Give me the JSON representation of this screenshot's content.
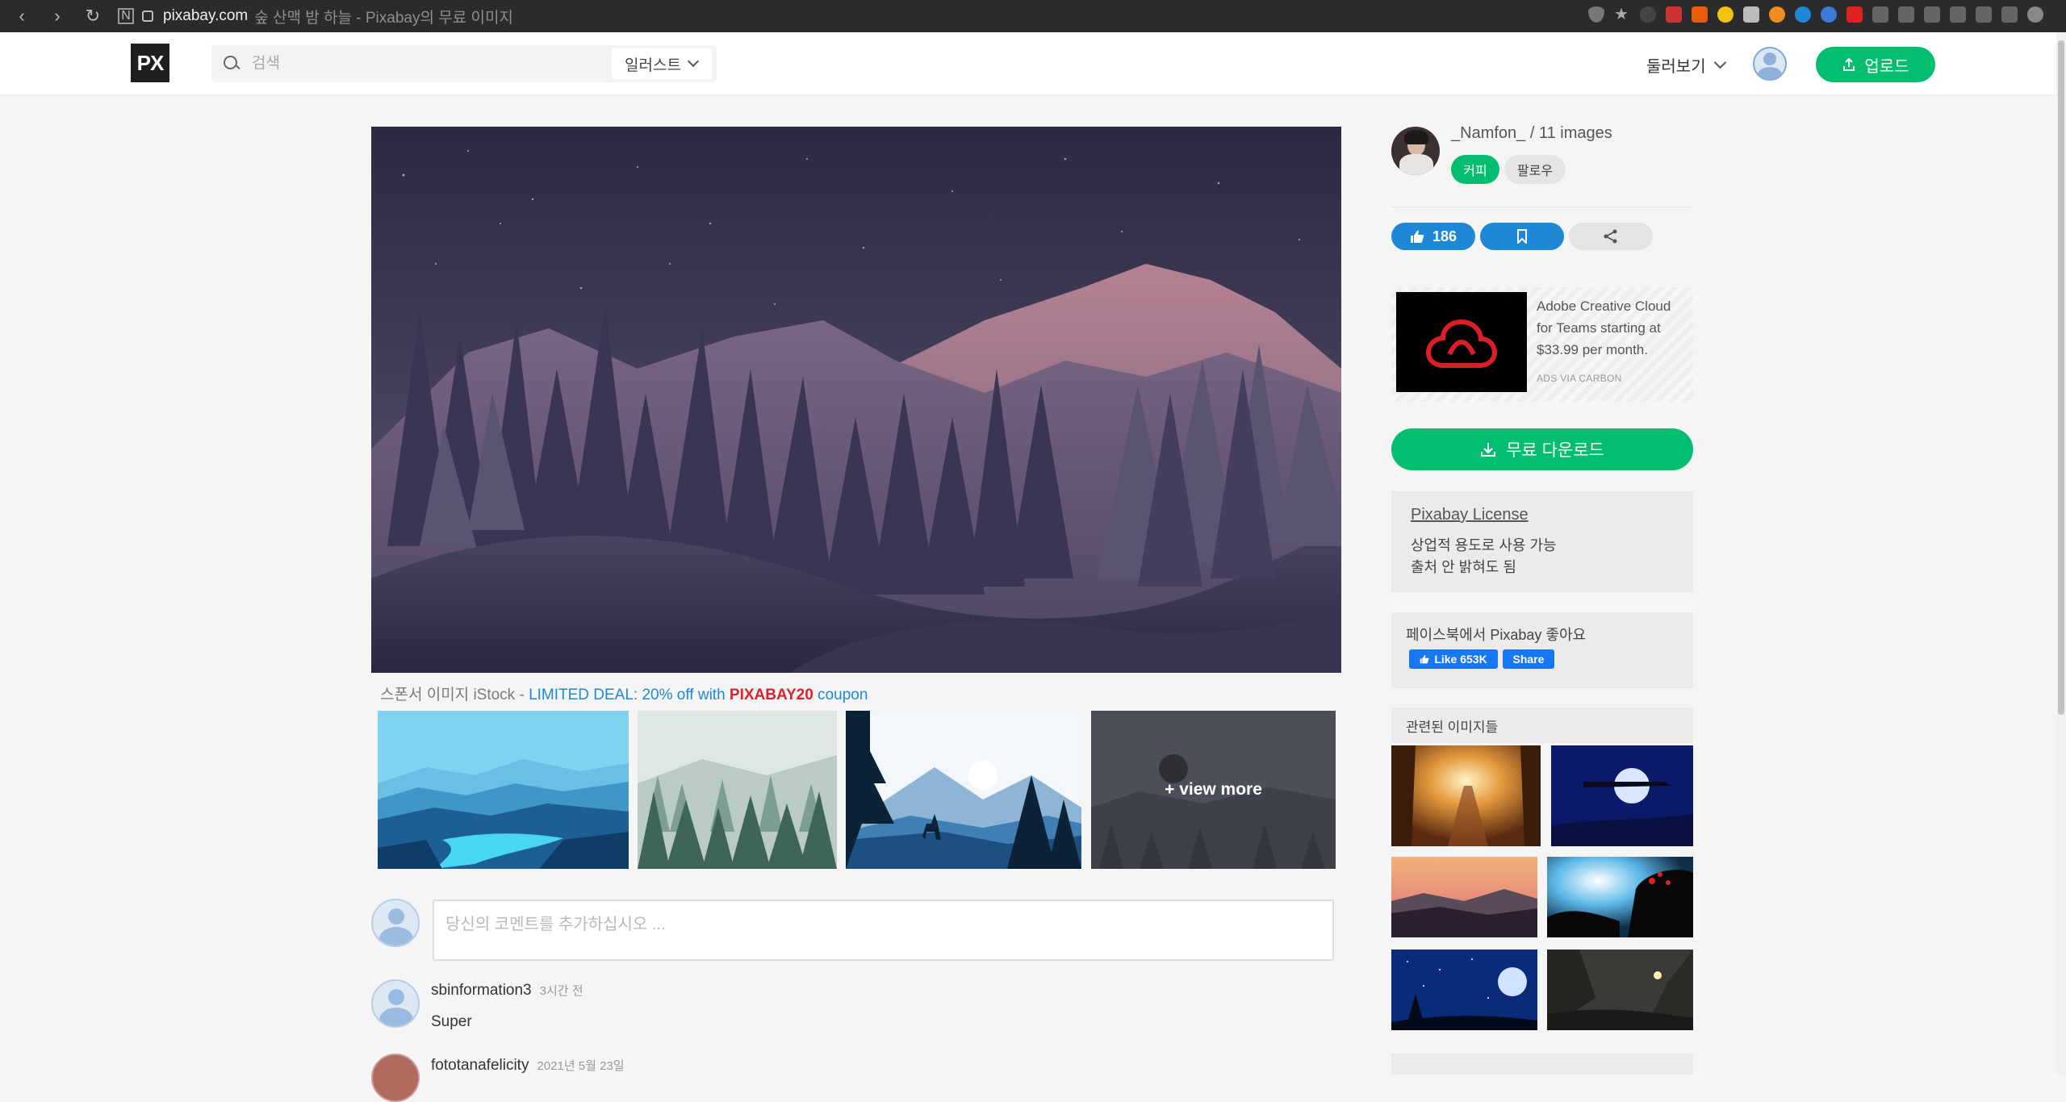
{
  "browser": {
    "host": "pixabay.com",
    "title": "숲 산맥 밤 하늘 - Pixabay의 무료 이미지"
  },
  "header": {
    "logo": "PX",
    "search_placeholder": "검색",
    "search_type": "일러스트",
    "explore_label": "둘러보기",
    "upload_label": "업로드"
  },
  "sponsor": {
    "prefix": "스폰서 이미지 iStock - ",
    "deal": "LIMITED DEAL: 20% off with ",
    "code": "PIXABAY20",
    "suffix": " coupon"
  },
  "thumbs": {
    "view_more": "+ view more"
  },
  "comments": {
    "placeholder": "당신의 코멘트를 추가하십시오 ...",
    "items": [
      {
        "user": "sbinformation3",
        "time": "3시간 전",
        "text": "Super"
      },
      {
        "user": "fototanafelicity",
        "time": "2021년 5월 23일",
        "text": ""
      }
    ]
  },
  "author": {
    "name": "_Namfon_ / 11 images",
    "coffee_label": "커피",
    "follow_label": "팔로우"
  },
  "actions": {
    "like_count": "186"
  },
  "ad": {
    "text": "Adobe Creative Cloud for Teams starting at $33.99 per month.",
    "via": "ADS VIA CARBON"
  },
  "download": {
    "label": "무료 다운로드"
  },
  "license": {
    "title": "Pixabay License",
    "line1": "상업적 용도로 사용 가능",
    "line2": "출처 안 밝혀도 됨"
  },
  "facebook": {
    "title": "페이스북에서 Pixabay 좋아요",
    "like_label": "Like 653K",
    "share_label": "Share"
  },
  "related": {
    "title": "관련된 이미지들"
  },
  "colors": {
    "green": "#02be6e",
    "blue": "#1e88d6",
    "coupon_red": "#e0202d"
  }
}
